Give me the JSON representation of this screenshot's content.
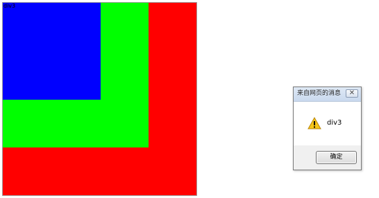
{
  "page": {
    "div_caption": "div3",
    "colors": {
      "div1": "#ff0000",
      "div2": "#00ff00",
      "div3": "#0000ff"
    }
  },
  "dialog": {
    "title": "来自网页的消息",
    "close_icon": "close-icon",
    "icon": "warning-icon",
    "message": "div3",
    "ok_label": "确定"
  }
}
